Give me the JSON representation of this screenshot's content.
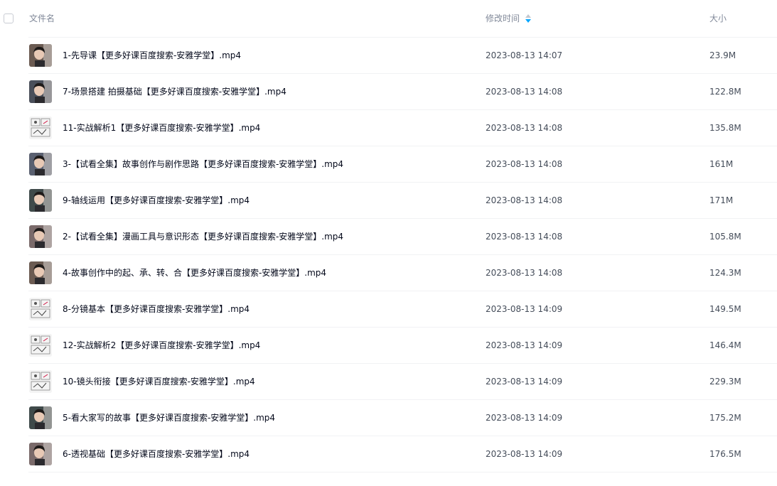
{
  "header": {
    "name_label": "文件名",
    "time_label": "修改时间",
    "size_label": "大小",
    "sort_icon": "sort-desc-icon",
    "sort_active_color": "#06a7ff"
  },
  "files": [
    {
      "name": "1-先导课【更多好课百度搜索-安雅学堂】.mp4",
      "time": "2023-08-13 14:07",
      "size": "23.9M",
      "thumb": "portrait"
    },
    {
      "name": "7-场景搭建 拍摄基础【更多好课百度搜索-安雅学堂】.mp4",
      "time": "2023-08-13 14:08",
      "size": "122.8M",
      "thumb": "portrait"
    },
    {
      "name": "11-实战解析1【更多好课百度搜索-安雅学堂】.mp4",
      "time": "2023-08-13 14:08",
      "size": "135.8M",
      "thumb": "sketch"
    },
    {
      "name": "3-【试看全集】故事创作与剧作思路【更多好课百度搜索-安雅学堂】.mp4",
      "time": "2023-08-13 14:08",
      "size": "161M",
      "thumb": "portrait"
    },
    {
      "name": "9-轴线运用【更多好课百度搜索-安雅学堂】.mp4",
      "time": "2023-08-13 14:08",
      "size": "171M",
      "thumb": "portrait"
    },
    {
      "name": "2-【试看全集】漫画工具与意识形态【更多好课百度搜索-安雅学堂】.mp4",
      "time": "2023-08-13 14:08",
      "size": "105.8M",
      "thumb": "portrait"
    },
    {
      "name": "4-故事创作中的起、承、转、合【更多好课百度搜索-安雅学堂】.mp4",
      "time": "2023-08-13 14:08",
      "size": "124.3M",
      "thumb": "portrait"
    },
    {
      "name": "8-分镜基本【更多好课百度搜索-安雅学堂】.mp4",
      "time": "2023-08-13 14:09",
      "size": "149.5M",
      "thumb": "sketch"
    },
    {
      "name": "12-实战解析2【更多好课百度搜索-安雅学堂】.mp4",
      "time": "2023-08-13 14:09",
      "size": "146.4M",
      "thumb": "sketch"
    },
    {
      "name": "10-镜头衔接【更多好课百度搜索-安雅学堂】.mp4",
      "time": "2023-08-13 14:09",
      "size": "229.3M",
      "thumb": "sketch"
    },
    {
      "name": "5-看大家写的故事【更多好课百度搜索-安雅学堂】.mp4",
      "time": "2023-08-13 14:09",
      "size": "175.2M",
      "thumb": "portrait"
    },
    {
      "name": "6-透视基础【更多好课百度搜索-安雅学堂】.mp4",
      "time": "2023-08-13 14:09",
      "size": "176.5M",
      "thumb": "portrait"
    }
  ]
}
